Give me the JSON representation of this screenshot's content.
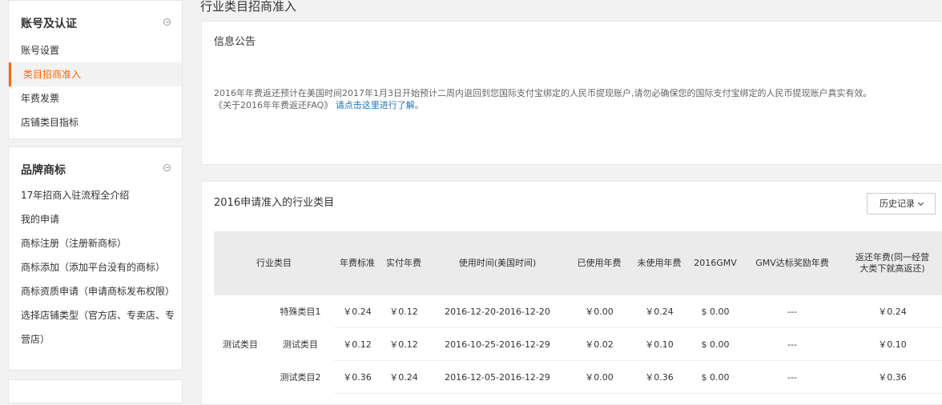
{
  "sidebar": {
    "section1": {
      "title": "账号及认证",
      "items": [
        {
          "label": "账号设置"
        },
        {
          "label": "类目招商准入"
        },
        {
          "label": "年费发票"
        },
        {
          "label": "店铺类目指标"
        }
      ]
    },
    "section2": {
      "title": "品牌商标",
      "items": [
        {
          "label": "17年招商入驻流程全介绍"
        },
        {
          "label": "我的申请"
        },
        {
          "label": "商标注册（注册新商标）"
        },
        {
          "label": "商标添加（添加平台没有的商标）"
        },
        {
          "label": "商标资质申请（申请商标发布权限）"
        },
        {
          "label": "选择店铺类型（官方店、专卖店、专"
        },
        {
          "label": "营店）"
        }
      ]
    }
  },
  "page_title": "行业类目招商准入",
  "notice": {
    "title": "信息公告",
    "line1": "2016年年费返还预计在美国时间2017年1月3日开始预计二周内退回到您国际支付宝绑定的人民币提现账户,请勿必确保您的国际支付宝绑定的人民币提现账户真实有效。",
    "line2_prefix": "《关于2016年年费返还FAQ》",
    "line2_link": "请点击这里进行了解",
    "line2_suffix": "。"
  },
  "categories": {
    "title": "2016申请准入的行业类目",
    "history_label": "历史记录",
    "headers": {
      "category": "行业类目",
      "standard_fee": "年费标准",
      "paid_fee": "实付年费",
      "usage_time": "使用时间(美国时间)",
      "used_fee": "已使用年费",
      "unused_fee": "未使用年费",
      "gmv": "2016GMV",
      "gmv_reward": "GMV达标奖励年费",
      "rebate_line1": "返还年费(同一经营",
      "rebate_line2": "大类下就高返还)"
    },
    "group": "测试类目",
    "rows": [
      {
        "sub": "特殊类目1",
        "standard": "￥0.24",
        "paid": "￥0.12",
        "time": "2016-12-20-2016-12-20",
        "used": "￥0.00",
        "unused": "￥0.24",
        "gmv": "$ 0.00",
        "reward": "---",
        "rebate": "￥0.24"
      },
      {
        "sub": "测试类目",
        "standard": "￥0.12",
        "paid": "￥0.12",
        "time": "2016-10-25-2016-12-29",
        "used": "￥0.02",
        "unused": "￥0.10",
        "gmv": "$ 0.00",
        "reward": "---",
        "rebate": "￥0.10"
      },
      {
        "sub": "测试类目2",
        "standard": "￥0.36",
        "paid": "￥0.24",
        "time": "2016-12-05-2016-12-29",
        "used": "￥0.00",
        "unused": "￥0.36",
        "gmv": "$ 0.00",
        "reward": "---",
        "rebate": "￥0.36"
      }
    ]
  }
}
